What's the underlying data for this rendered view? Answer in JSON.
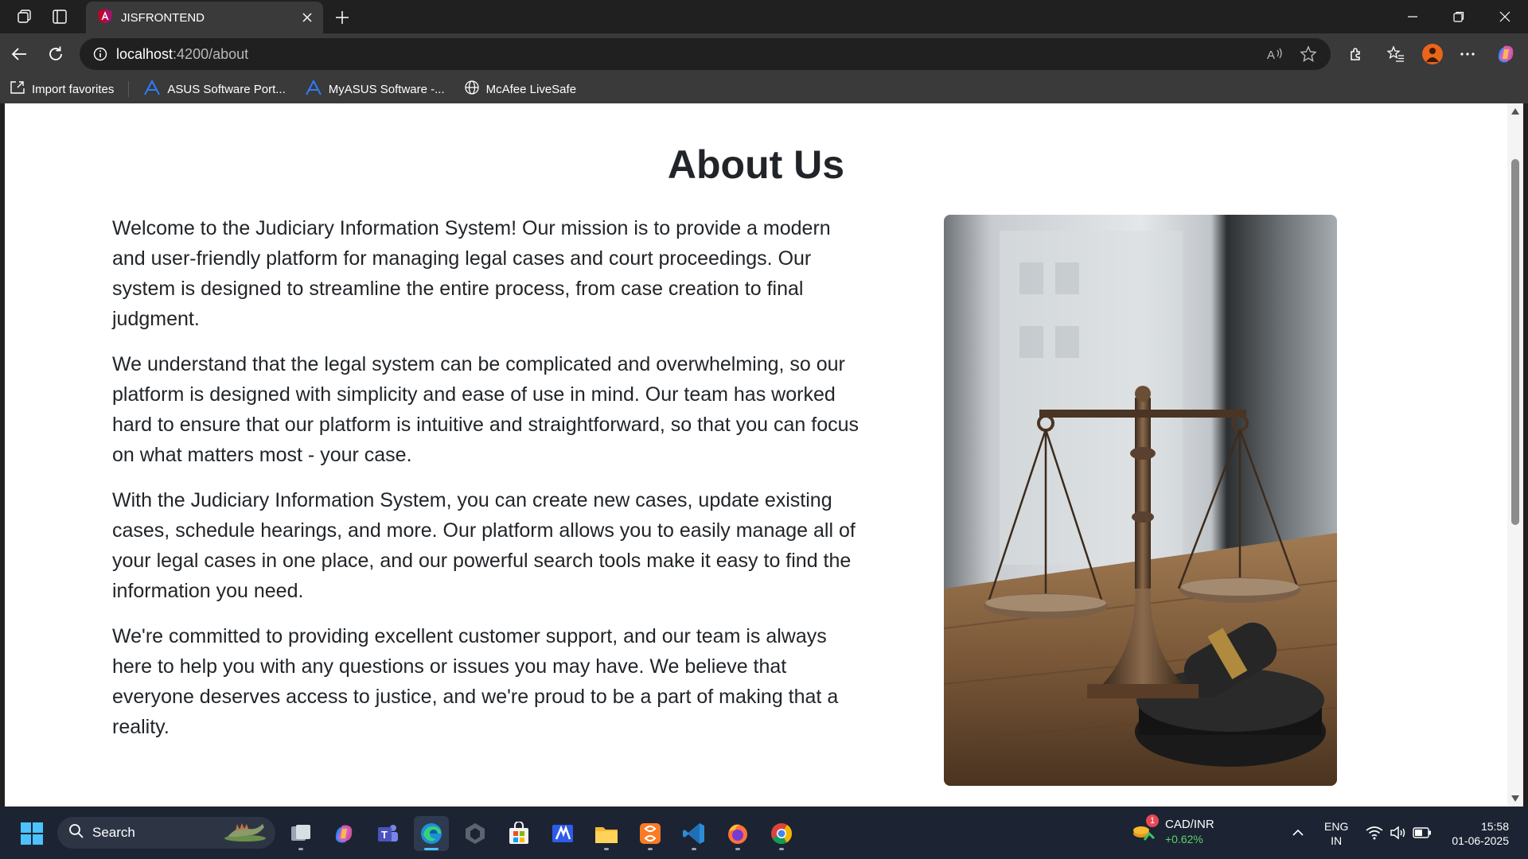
{
  "browser": {
    "tab_title": "JISFRONTEND",
    "url_host": "localhost",
    "url_path": ":4200/about",
    "favorites": [
      {
        "label": "Import favorites",
        "icon": "import-favorites-icon"
      },
      {
        "label": "ASUS Software Port...",
        "icon": "asus-logo-icon"
      },
      {
        "label": "MyASUS Software -...",
        "icon": "asus-logo-icon"
      },
      {
        "label": "McAfee LiveSafe",
        "icon": "globe-icon"
      }
    ]
  },
  "page": {
    "title": "About Us",
    "paragraphs": [
      "Welcome to the Judiciary Information System! Our mission is to provide a modern and user-friendly platform for managing legal cases and court proceedings. Our system is designed to streamline the entire process, from case creation to final judgment.",
      "We understand that the legal system can be complicated and overwhelming, so our platform is designed with simplicity and ease of use in mind. Our team has worked hard to ensure that our platform is intuitive and straightforward, so that you can focus on what matters most - your case.",
      "With the Judiciary Information System, you can create new cases, update existing cases, schedule hearings, and more. Our platform allows you to easily manage all of your legal cases in one place, and our powerful search tools make it easy to find the information you need.",
      "We're committed to providing excellent customer support, and our team is always here to help you with any questions or issues you may have. We believe that everyone deserves access to justice, and we're proud to be a part of making that a reality."
    ],
    "image_subject": "scales-of-justice-and-gavel"
  },
  "taskbar": {
    "search_label": "Search",
    "ticker_name": "CAD/INR",
    "ticker_change": "+0.62%",
    "ticker_badge": "1",
    "lang_line1": "ENG",
    "lang_line2": "IN",
    "time": "15:58",
    "date": "01-06-2025"
  },
  "colors": {
    "browser_dark": "#202020",
    "browser_chrome": "#3a3a3a",
    "page_text": "#212529",
    "taskbar_bg": "#1c2433",
    "ticker_up": "#5fd068",
    "accent": "#4cc2ff"
  }
}
